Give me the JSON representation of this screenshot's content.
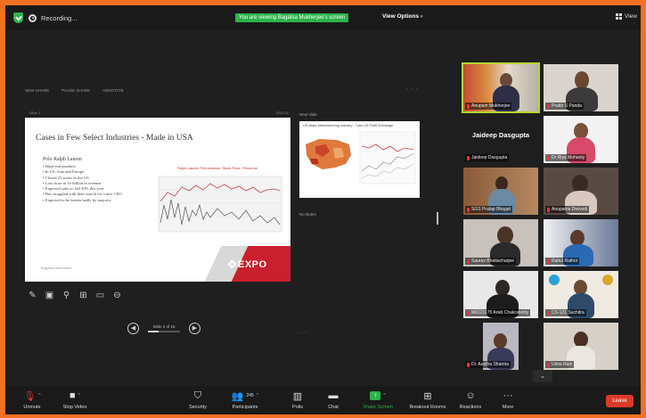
{
  "topbar": {
    "recording_label": "Recording...",
    "viewing_notice": "You are viewing Bagatsa Mukherjee's screen",
    "view_options_label": "View Options",
    "view_label": "View"
  },
  "share": {
    "toolbar_items": [
      "NEW SHARE",
      "PAUSE SHARE",
      "ANNOTATE"
    ],
    "ppt_left": "Slide 2",
    "ppt_right": "2023-01",
    "side_panel_label": "Next slide",
    "notes_label": "No Notes",
    "slide_counter": "Slide 2 of 15"
  },
  "slide": {
    "title": "Cases in Few Select Industries - Made in USA",
    "subtitle": "Polo Ralph Lauren",
    "bullets": [
      "High-end products",
      "In US, Asia and Europe",
      "Closed 25 stores in the US",
      "Lost close to 10 billion in revenue",
      "Expected sales to fall 20% this year",
      "Has struggled with their search for a new CEO",
      "Expected to be beaten badly by majority"
    ],
    "chart_title": "Ralph Lauren Performance: Stock Price / Revenue",
    "author": "Bagatsa Mukherjee",
    "logo_text": "EXPO"
  },
  "thumb": {
    "title": "US Major Manufacturing Industry - Total US Profit Shrinkage"
  },
  "gallery": {
    "tiles": [
      {
        "name": "Anupam Mukherjee"
      },
      {
        "name": "Prabir S Panda"
      },
      {
        "name": "Jaideep Dasgupta",
        "big": "Jaideep Dasgupta"
      },
      {
        "name": "Dr Riya Mohanty"
      },
      {
        "name": "SGS Pratap Bhagat"
      },
      {
        "name": "Anupama Dwivedi"
      },
      {
        "name": "Saurav Bhattacharjee"
      },
      {
        "name": "Rahul Rathor"
      },
      {
        "name": "M0121175 Ankit Chakraborty"
      },
      {
        "name": "CS-121 Suchitra"
      },
      {
        "name": "Dr. Aastha Sharma"
      },
      {
        "name": "Usha Rani"
      }
    ]
  },
  "toolbar": {
    "unmute": "Unmute",
    "stop_video": "Stop Video",
    "security": "Security",
    "participants": "Participants",
    "participants_count": "245",
    "polls": "Polls",
    "chat": "Chat",
    "share_screen": "Share Screen",
    "breakout": "Breakout Rooms",
    "reactions": "Reactions",
    "more": "More",
    "leave": "Leave"
  },
  "colors": {
    "border": "#f36f21",
    "share_green": "#2cb24a",
    "leave_red": "#d93b2b",
    "active_speaker": "#b5d633"
  }
}
